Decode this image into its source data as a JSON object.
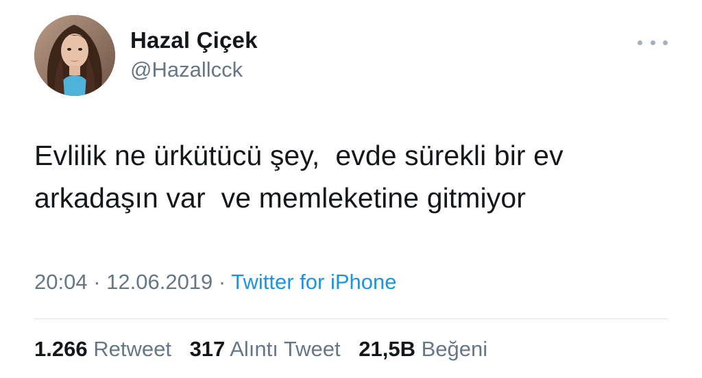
{
  "profile": {
    "display_name": "Hazal Çiçek",
    "handle": "@Hazallcck"
  },
  "tweet": {
    "text": "Evlilik ne ürkütücü şey,  evde sürekli bir ev\narkadaşın var  ve memleketine gitmiyor",
    "time": "20:04",
    "separator": " · ",
    "date": "12.06.2019",
    "source": "Twitter for iPhone"
  },
  "stats": {
    "retweets": {
      "count": "1.266",
      "label": "Retweet"
    },
    "quotes": {
      "count": "317",
      "label": "Alıntı Tweet"
    },
    "likes": {
      "count": "21,5B",
      "label": "Beğeni"
    }
  },
  "colors": {
    "text": "#14171a",
    "secondary": "#657786",
    "link": "#1b95e0",
    "divider": "#dfe3e7"
  },
  "icons": {
    "more": "more-horizontal-icon"
  }
}
